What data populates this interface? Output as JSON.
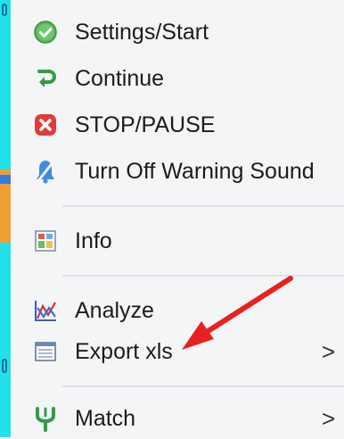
{
  "menu": {
    "items": [
      {
        "label": "Settings/Start",
        "icon": "check-circle-icon"
      },
      {
        "label": "Continue",
        "icon": "continue-icon"
      },
      {
        "label": "STOP/PAUSE",
        "icon": "stop-octagon-icon"
      },
      {
        "label": "Turn Off Warning Sound",
        "icon": "bell-off-icon"
      },
      {
        "label": "Info",
        "icon": "info-grid-icon"
      },
      {
        "label": "Analyze",
        "icon": "chart-analyze-icon"
      },
      {
        "label": "Export xls",
        "icon": "spreadsheet-icon",
        "submenu": ">"
      },
      {
        "label": "Match",
        "icon": "fork-icon",
        "submenu": ">"
      }
    ]
  },
  "colors": {
    "accent_strip": "#22e1e9",
    "annotation_arrow": "#e8201e"
  }
}
